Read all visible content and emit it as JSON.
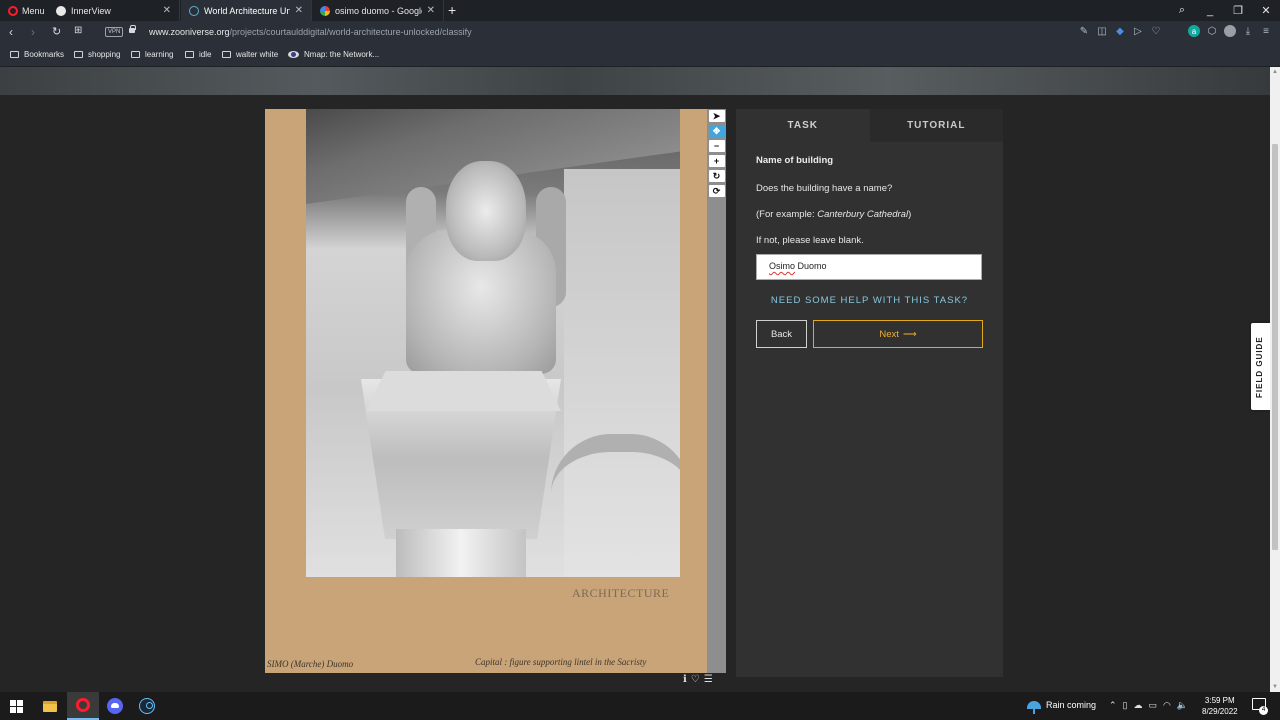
{
  "browser": {
    "menu_label": "Menu",
    "tabs": [
      {
        "title": "InnerView",
        "active": false
      },
      {
        "title": "World Architecture Unlock",
        "active": true
      },
      {
        "title": "osimo duomo - Google Sea",
        "active": false
      }
    ],
    "url_host": "www.zooniverse.org",
    "url_path": "/projects/courtaulddigital/world-architecture-unlocked/classify",
    "vpn_label": "VPN",
    "bookmarks": [
      "Bookmarks",
      "shopping",
      "learning",
      "idle",
      "walter white",
      "Nmap: the Network..."
    ]
  },
  "viewer": {
    "stamp_text": "ARCHITECTURE",
    "caption_left": "SIMO    (Marche)   Duomo",
    "caption_right": "Capital : figure supporting lintel in the Sacristy"
  },
  "task": {
    "tabs": [
      "TASK",
      "TUTORIAL"
    ],
    "title": "Name of building",
    "question": "Does the building have a name?",
    "example_prefix": "(For example: ",
    "example_name": "Canterbury Cathedral",
    "example_suffix": ")",
    "hint": "If not, please leave blank.",
    "answer_word1": "Osimo",
    "answer_word2": " Duomo",
    "help_link": "NEED SOME HELP WITH THIS TASK?",
    "back_label": "Back",
    "next_label": "Next",
    "next_arrow": "⟶"
  },
  "field_guide_label": "FIELD GUIDE",
  "taskbar": {
    "weather": "Rain coming",
    "time": "3:59 PM",
    "date": "8/29/2022",
    "notifications": "4"
  },
  "colors": {
    "accent_next": "#f0b12c",
    "help_link": "#86c8df",
    "tool_selected": "#42a5dc"
  }
}
